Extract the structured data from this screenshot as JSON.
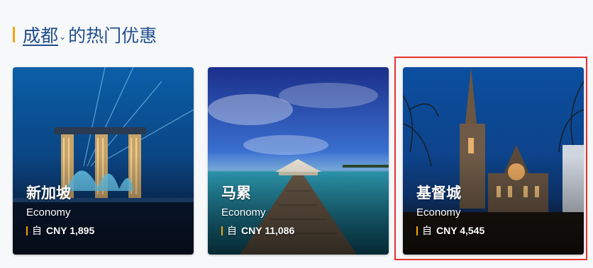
{
  "header": {
    "city": "成都",
    "title_rest": "的热门优惠",
    "chevron_icon": "chevron-down-icon",
    "accent_color": "#f5a300",
    "title_color": "#1f4e8c"
  },
  "offers": [
    {
      "destination": "新加坡",
      "cabin": "Economy",
      "from_label": "自",
      "price": "CNY 1,895"
    },
    {
      "destination": "马累",
      "cabin": "Economy",
      "from_label": "自",
      "price": "CNY 11,086"
    },
    {
      "destination": "基督城",
      "cabin": "Economy",
      "from_label": "自",
      "price": "CNY 4,545"
    }
  ],
  "highlight_color": "#e8312e"
}
